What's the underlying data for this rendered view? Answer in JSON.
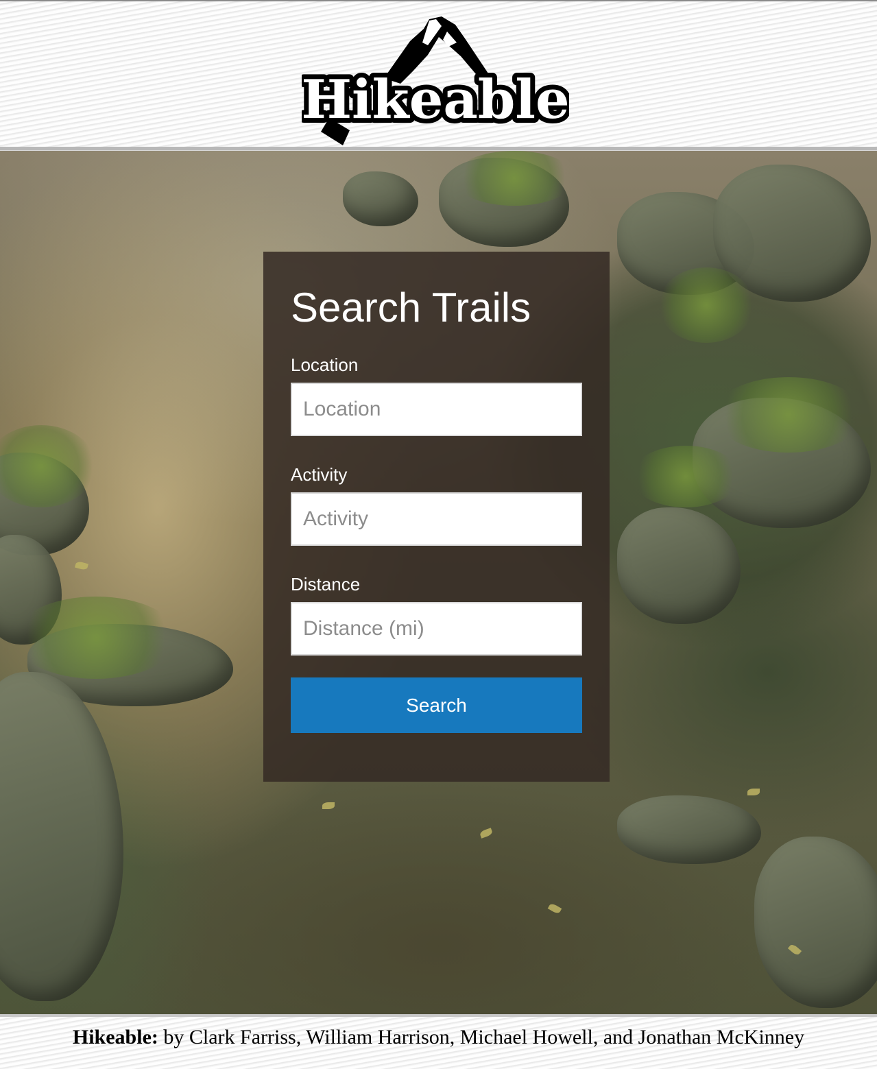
{
  "header": {
    "logo_text": "Hikeable"
  },
  "search_panel": {
    "title": "Search Trails",
    "location": {
      "label": "Location",
      "placeholder": "Location",
      "value": ""
    },
    "activity": {
      "label": "Activity",
      "placeholder": "Activity",
      "value": ""
    },
    "distance": {
      "label": "Distance",
      "placeholder": "Distance (mi)",
      "value": ""
    },
    "search_button_label": "Search"
  },
  "footer": {
    "brand": "Hikeable:",
    "credits": " by Clark Farriss, William Harrison, Michael Howell, and Jonathan McKinney"
  },
  "colors": {
    "button_primary": "#1779be",
    "panel_background": "#342a24",
    "text_on_panel": "#ffffff"
  }
}
